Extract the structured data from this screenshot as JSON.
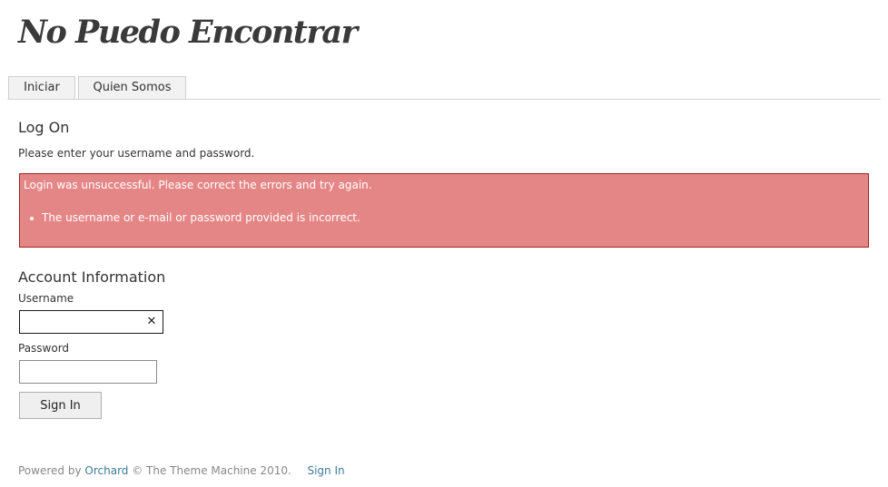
{
  "site": {
    "title": "No Puedo Encontrar"
  },
  "menu": {
    "tabs": [
      {
        "label": "Iniciar"
      },
      {
        "label": "Quien Somos"
      }
    ]
  },
  "page": {
    "heading": "Log On",
    "instructions": "Please enter your username and password."
  },
  "error": {
    "summary": "Login was unsuccessful. Please correct the errors and try again.",
    "items": [
      "The username or e-mail or password provided is incorrect."
    ],
    "background_color": "#e58686",
    "border_color": "#9c2424"
  },
  "account": {
    "heading": "Account Information",
    "username_label": "Username",
    "username_value": "",
    "password_label": "Password",
    "password_value": "",
    "clear_icon": "close-icon",
    "submit_label": "Sign In"
  },
  "footer": {
    "powered_by": "Powered by",
    "orchard_link": "Orchard",
    "copyright": "© The Theme Machine 2010.",
    "sign_in_link": "Sign In",
    "link_color": "#3d7a98"
  }
}
